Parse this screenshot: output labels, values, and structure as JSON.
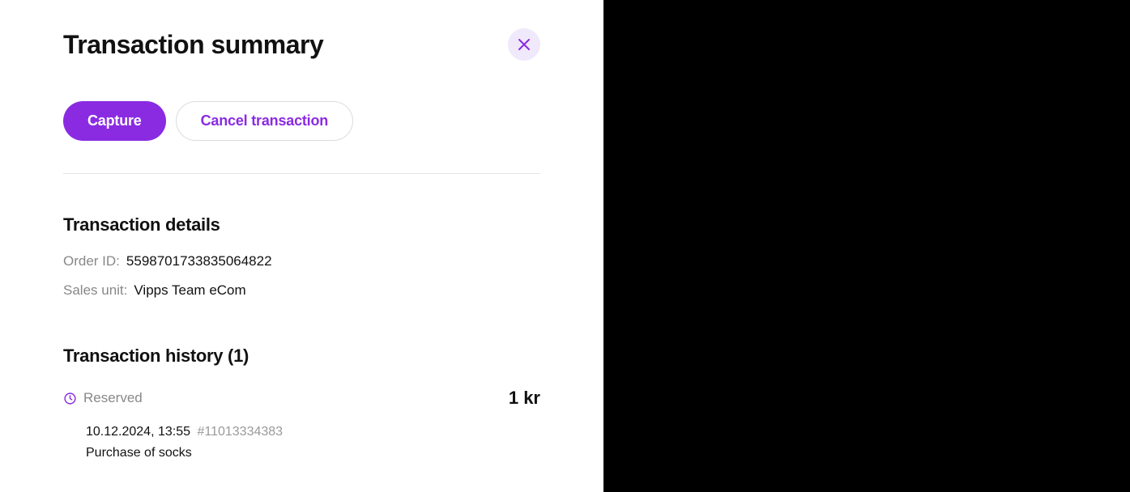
{
  "header": {
    "title": "Transaction summary"
  },
  "actions": {
    "capture_label": "Capture",
    "cancel_label": "Cancel transaction"
  },
  "details": {
    "section_title": "Transaction details",
    "order_id_label": "Order ID:",
    "order_id_value": "5598701733835064822",
    "sales_unit_label": "Sales unit:",
    "sales_unit_value": "Vipps Team eCom"
  },
  "history": {
    "section_title": "Transaction history (1)",
    "items": [
      {
        "status": "Reserved",
        "amount": "1 kr",
        "timestamp": "10.12.2024, 13:55",
        "reference": "#11013334383",
        "description": "Purchase of socks"
      }
    ]
  }
}
